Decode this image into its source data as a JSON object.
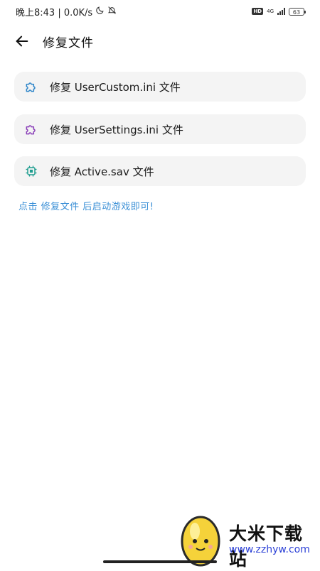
{
  "status_bar": {
    "time_speed": "晚上8:43 | 0.0K/s",
    "hd_badge": "HD",
    "network_type": "4G",
    "battery_level": "63"
  },
  "header": {
    "title": "修复文件"
  },
  "actions": [
    {
      "label": "修复 UserCustom.ini 文件",
      "icon": "puzzle-icon",
      "icon_color": "#2f86c9"
    },
    {
      "label": "修复 UserSettings.ini 文件",
      "icon": "puzzle-icon",
      "icon_color": "#8a3fb8"
    },
    {
      "label": "修复 Active.sav 文件",
      "icon": "chip-icon",
      "icon_color": "#1f9d8f"
    }
  ],
  "hint": "点击 修复文件 后启动游戏即可!",
  "watermark": {
    "brand": "大米下载站",
    "url": "www.zzhyw.com"
  },
  "colors": {
    "hint": "#3a8fd6",
    "card_bg": "#f4f4f4"
  }
}
